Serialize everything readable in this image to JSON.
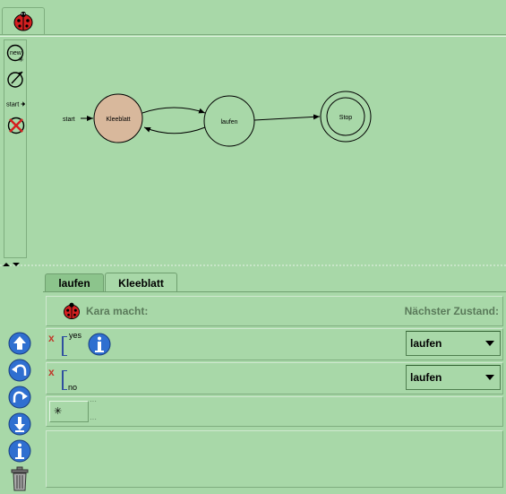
{
  "window": {
    "tab_icon": "ladybug-icon"
  },
  "toolbar": {
    "tools": [
      {
        "name": "new-state-icon",
        "label": "new"
      },
      {
        "name": "edit-transition-icon"
      },
      {
        "name": "set-start-icon",
        "label": "start"
      },
      {
        "name": "delete-icon"
      }
    ]
  },
  "diagram": {
    "start_label": "start",
    "states": [
      {
        "name": "Kleeblatt",
        "fill": "#d8b89c"
      },
      {
        "name": "laufen",
        "fill": "#a8d8a8"
      },
      {
        "name": "Stop",
        "fill": "#a8d8a8",
        "final": true
      }
    ]
  },
  "tabs": [
    {
      "label": "laufen"
    },
    {
      "label": "Kleeblatt",
      "active": true
    }
  ],
  "editor": {
    "header_left": "Kara macht:",
    "header_right": "Nächster Zustand:",
    "rows": [
      {
        "sensor_value": "yes",
        "next_state": "laufen"
      },
      {
        "sensor_value": "no",
        "next_state": "laufen"
      }
    ]
  },
  "colors": {
    "background": "#a8d8a8",
    "accent_blue": "#2f6fd0",
    "delete_red": "#c0392b"
  }
}
